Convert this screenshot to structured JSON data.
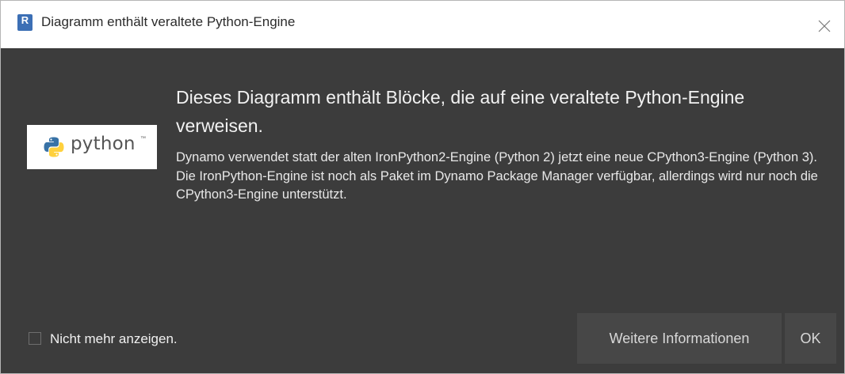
{
  "window": {
    "title": "Diagramm enthält veraltete Python-Engine",
    "app_icon_letter": "R"
  },
  "logo": {
    "wordmark": "python",
    "trademark": "™"
  },
  "message": {
    "heading": "Dieses Diagramm enthält Blöcke, die auf eine veraltete Python-Engine verweisen.",
    "paragraph1": "Dynamo verwendet statt der alten IronPython2-Engine (Python 2) jetzt eine neue CPython3-Engine (Python 3).",
    "paragraph2": "Die IronPython-Engine ist noch als Paket im Dynamo Package Manager verfügbar, allerdings wird nur noch die CPython3-Engine unterstützt."
  },
  "footer": {
    "checkbox_label": "Nicht mehr anzeigen.",
    "checkbox_checked": false,
    "more_info_label": "Weitere Informationen",
    "ok_label": "OK"
  },
  "colors": {
    "dialog_background": "#3c3c3c",
    "button_background": "#474747",
    "titlebar_background": "#ffffff",
    "python_blue": "#3872a6",
    "python_yellow": "#ffd13d"
  },
  "icons": {
    "app": "revit-app-icon",
    "close": "close-icon",
    "logo": "python-logo-icon"
  }
}
